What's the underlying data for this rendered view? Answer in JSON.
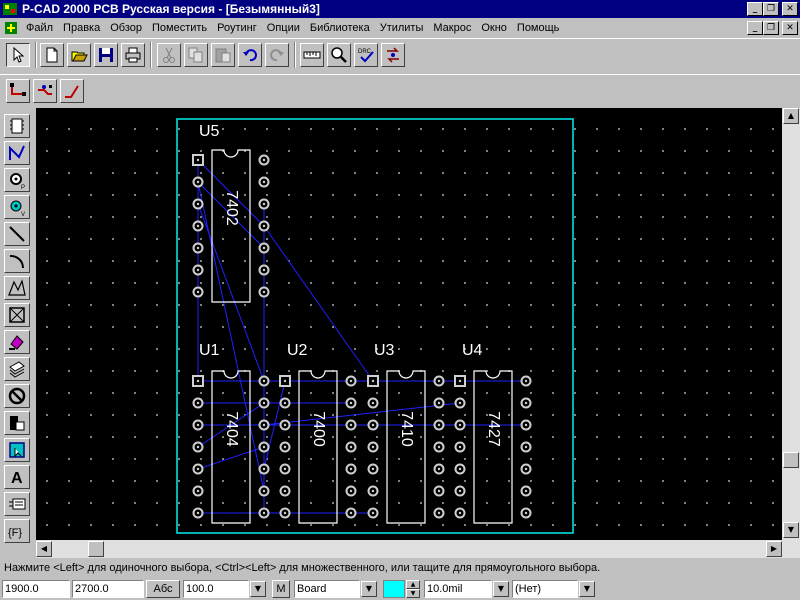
{
  "window": {
    "title": "P-CAD 2000 PCB Русская версия - [Безымянный3]"
  },
  "menu": {
    "items": [
      "Файл",
      "Правка",
      "Обзор",
      "Поместить",
      "Роутинг",
      "Опции",
      "Библиотека",
      "Утилиты",
      "Макрос",
      "Окно",
      "Помощь"
    ]
  },
  "toolbar": {
    "icons": [
      "select-arrow-icon",
      "new-file-icon",
      "open-file-icon",
      "save-icon",
      "print-icon",
      "cut-icon",
      "copy-icon",
      "paste-icon",
      "undo-icon",
      "redo-icon",
      "measure-icon",
      "zoom-icon",
      "drc-icon",
      "swap-icon"
    ],
    "drc_label": "DRC"
  },
  "route_toolbar": {
    "icons": [
      "route-manual-icon",
      "route-interactive-icon",
      "route-miter-icon"
    ]
  },
  "left_toolbar": {
    "icons": [
      "place-component-icon",
      "place-connection-icon",
      "place-pad-icon",
      "place-via-icon",
      "place-line-icon",
      "place-arc-icon",
      "place-polygon-icon",
      "place-keepout-icon",
      "place-copper-pour-icon",
      "place-cutout-icon",
      "place-noconnect-icon",
      "place-plane-icon",
      "place-room-icon",
      "place-text-icon",
      "place-attribute-icon",
      "place-field-icon"
    ],
    "text_label": "A",
    "field_label": "{F}"
  },
  "board": {
    "outline_color": "#00e0e0",
    "ratsnest_color": "#2020ff",
    "pad_color": "#d0d0d0",
    "components": [
      {
        "ref": "U5",
        "part": "7402"
      },
      {
        "ref": "U1",
        "part": "7404"
      },
      {
        "ref": "U2",
        "part": "7400"
      },
      {
        "ref": "U3",
        "part": "7410"
      },
      {
        "ref": "U4",
        "part": "7427"
      }
    ]
  },
  "status": {
    "hint": "Нажмите <Left> для одиночного выбора, <Ctrl><Left> для множественного, или тащите для прямоугольного выбора."
  },
  "bottom": {
    "x": "1900.0",
    "y": "2700.0",
    "abs_button": "Абс",
    "zoom": "100.0",
    "m_button": "M",
    "layer": "Board",
    "layer_color": "#00ffff",
    "line_width": "10.0mil",
    "net": "(Нет)"
  }
}
